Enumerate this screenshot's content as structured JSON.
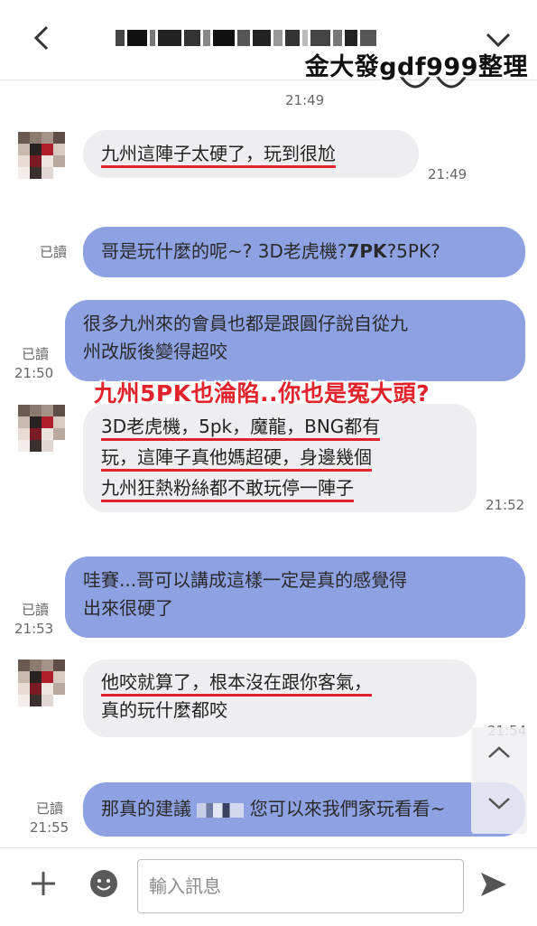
{
  "header": {
    "watermark": "金大發gdf999整理"
  },
  "caption": {
    "text": "九州5PK也淪陷..你也是冤大頭?"
  },
  "messages": [
    {
      "type": "time",
      "time": "21:49"
    },
    {
      "type": "in",
      "lines": [
        "九州這陣子太硬了，玩到很尬"
      ],
      "time": "21:49"
    },
    {
      "type": "out",
      "read": "已讀",
      "line_a": "哥是玩什麼的呢~? 3D老虎機?",
      "line_b": "7PK",
      "line_c": "?5PK?"
    },
    {
      "type": "out",
      "read": "已讀",
      "time": "21:50",
      "lines": [
        "很多九州來的會員也都是跟圓仔說自從九",
        "州改版後變得超咬"
      ]
    },
    {
      "type": "in",
      "lines": [
        "3D老虎機，5pk，魔龍，BNG都有",
        "玩，這陣子真他媽超硬，身邊幾個",
        "九州狂熱粉絲都不敢玩停一陣子"
      ],
      "time": "21:52"
    },
    {
      "type": "out",
      "read": "已讀",
      "time": "21:53",
      "lines": [
        "哇賽...哥可以講成這樣一定是真的感覺得",
        "出來很硬了"
      ]
    },
    {
      "type": "in",
      "lines": [
        "他咬就算了，根本沒在跟你客氣，",
        "真的玩什麼都咬"
      ],
      "time": "21:54"
    },
    {
      "type": "out",
      "read": "已讀",
      "time": "21:55",
      "line_a": "那真的建議",
      "line_b": "您可以來我們家玩看看~"
    }
  ],
  "input": {
    "placeholder": "輸入訊息"
  },
  "icons": {
    "back": "chevron-left-icon",
    "collapse": "chevron-down-icon",
    "scroll_up": "chevron-up-icon",
    "scroll_down": "chevron-down-icon",
    "add": "plus-icon",
    "emoji": "smiley-icon",
    "send": "send-arrow-icon"
  },
  "colors": {
    "outgoing_bubble": "#8ea2e3",
    "incoming_bubble": "#eeeef0",
    "underline_red": "#e3232b"
  }
}
